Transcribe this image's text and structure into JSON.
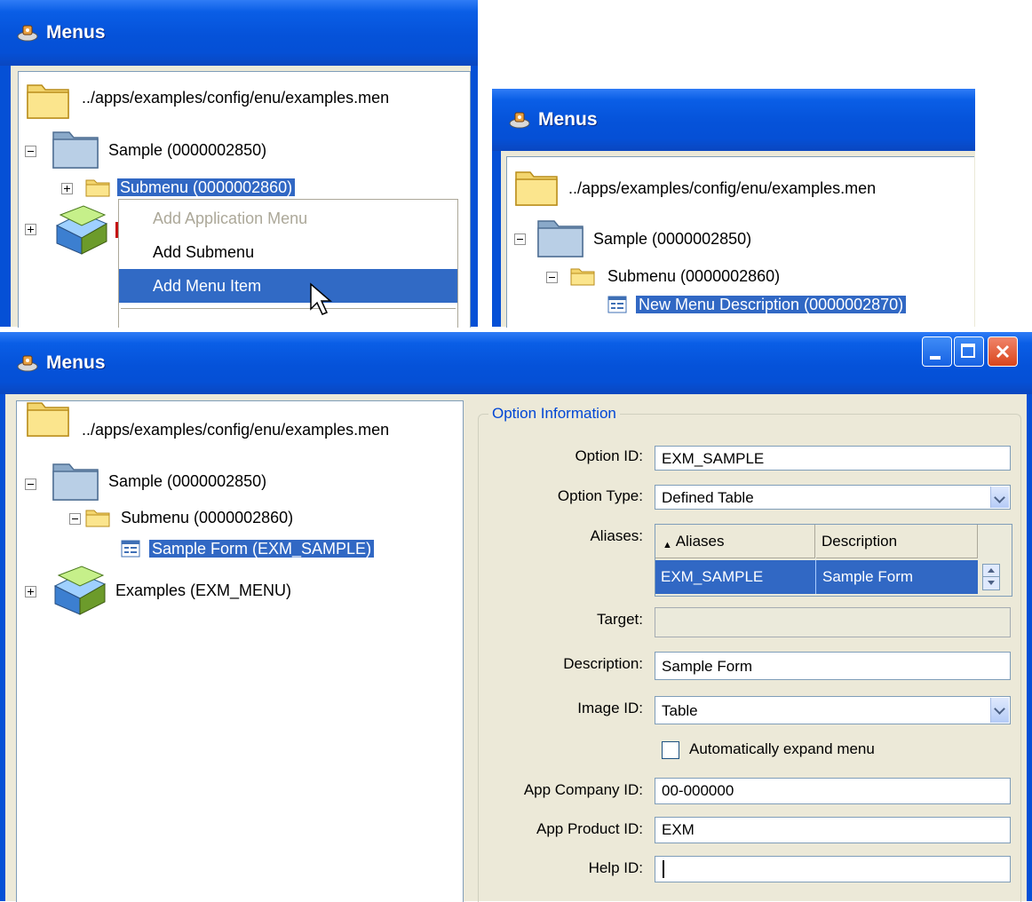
{
  "window_title": "Menus",
  "root_path": "../apps/examples/config/enu/examples.men",
  "panel1": {
    "sample_node": "Sample (0000002850)",
    "submenu_node": "Submenu (0000002860)",
    "context_menu": [
      "Add Application Menu",
      "Add Submenu",
      "Add Menu Item"
    ]
  },
  "panel2": {
    "sample_node": "Sample (0000002850)",
    "submenu_node": "Submenu (0000002860)",
    "new_item_node": "New Menu Description (0000002870)"
  },
  "panel3": {
    "sample_node": "Sample  (0000002850)",
    "submenu_node": "Submenu  (0000002860)",
    "form_node": "Sample Form (EXM_SAMPLE)",
    "examples_node": "Examples  (EXM_MENU)",
    "group_title": "Option Information",
    "labels": {
      "option_id": "Option ID:",
      "option_type": "Option Type:",
      "aliases": "Aliases:",
      "target": "Target:",
      "description": "Description:",
      "image_id": "Image ID:",
      "app_company_id": "App Company ID:",
      "app_product_id": "App Product ID:",
      "help_id": "Help ID:"
    },
    "values": {
      "option_id": "EXM_SAMPLE",
      "option_type": "Defined Table",
      "target": "",
      "description": "Sample Form",
      "image_id": "Table",
      "app_company_id": "00-000000",
      "app_product_id": "EXM",
      "help_id": ""
    },
    "aliases_table": {
      "columns": [
        "Aliases",
        "Description"
      ],
      "rows": [
        [
          "EXM_SAMPLE",
          "Sample Form"
        ]
      ]
    },
    "auto_expand_label": "Automatically expand menu",
    "auto_expand_checked": false
  },
  "colors": {
    "titlebar": "#0550d6",
    "selection": "#3168c4",
    "group_title": "#0046d5",
    "dialog_bg": "#ece9d8"
  }
}
